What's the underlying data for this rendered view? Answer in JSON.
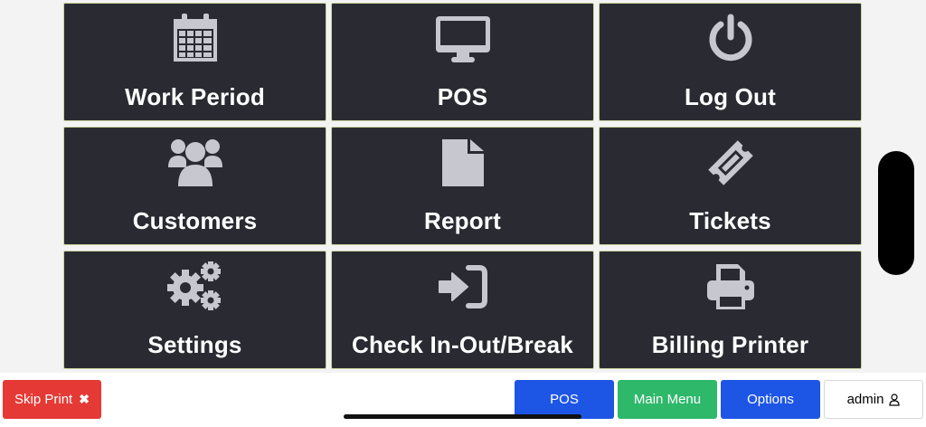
{
  "menu": {
    "tiles": [
      {
        "label": "Work Period",
        "icon": "calendar-icon"
      },
      {
        "label": "POS",
        "icon": "monitor-icon"
      },
      {
        "label": "Log Out",
        "icon": "power-icon"
      },
      {
        "label": "Customers",
        "icon": "users-icon"
      },
      {
        "label": "Report",
        "icon": "file-icon"
      },
      {
        "label": "Tickets",
        "icon": "ticket-icon"
      },
      {
        "label": "Settings",
        "icon": "gears-icon"
      },
      {
        "label": "Check In-Out/Break",
        "icon": "sign-in-icon"
      },
      {
        "label": "Billing Printer",
        "icon": "printer-icon"
      }
    ]
  },
  "bottom_bar": {
    "skip_print": "Skip Print",
    "pos": "POS",
    "main_menu": "Main Menu",
    "options": "Options",
    "user": "admin"
  },
  "colors": {
    "tile_bg": "#2a2b32",
    "icon": "#c7c7d0",
    "danger": "#e53935",
    "primary": "#1d55e5",
    "success": "#2eb86a"
  }
}
